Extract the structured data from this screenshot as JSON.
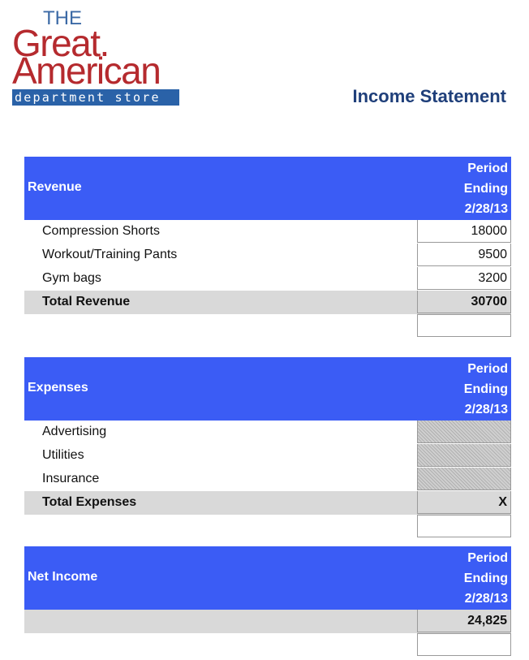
{
  "logo": {
    "line1": "THE",
    "line2": "Great.",
    "line3": "American",
    "line4": "department store"
  },
  "title": "Income Statement",
  "revenue": {
    "label": "Revenue",
    "period": [
      "Period",
      "Ending",
      "2/28/13"
    ],
    "rows": [
      {
        "label": "Compression Shorts",
        "value": "18000"
      },
      {
        "label": "Workout/Training Pants",
        "value": "9500"
      },
      {
        "label": "Gym bags",
        "value": "3200"
      }
    ],
    "total_label": "Total Revenue",
    "total_value": "30700"
  },
  "expenses": {
    "label": "Expenses",
    "period": [
      "Period",
      "Ending",
      "2/28/13"
    ],
    "rows": [
      {
        "label": "Advertising",
        "value": ""
      },
      {
        "label": "Utilities",
        "value": ""
      },
      {
        "label": "Insurance",
        "value": ""
      }
    ],
    "total_label": "Total Expenses",
    "total_value": "X"
  },
  "net_income": {
    "label": "Net Income",
    "period": [
      "Period",
      "Ending",
      "2/28/13"
    ],
    "value": "24,825"
  },
  "colors": {
    "header_blue": "#3b5cf5",
    "title_navy": "#1f3f7a",
    "logo_red": "#b52a2e",
    "logo_blue": "#2a62a8",
    "total_gray": "#d9d9d9"
  }
}
